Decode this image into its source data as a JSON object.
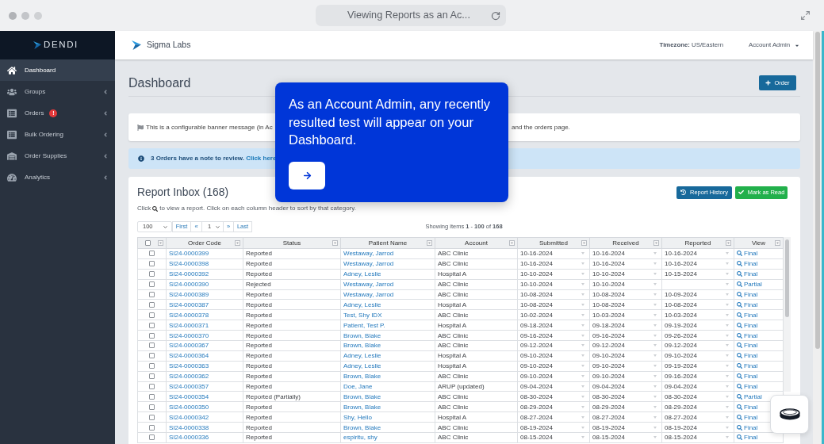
{
  "browser": {
    "address": "Viewing Reports as an Ac..."
  },
  "sidebar": {
    "logo": "DENDI",
    "items": [
      {
        "label": "Dashboard",
        "selected": true,
        "has_submenu": false
      },
      {
        "label": "Groups",
        "selected": false,
        "has_submenu": true
      },
      {
        "label": "Orders",
        "selected": false,
        "has_submenu": true,
        "badge": "!"
      },
      {
        "label": "Bulk Ordering",
        "selected": false,
        "has_submenu": true
      },
      {
        "label": "Order Supplies",
        "selected": false,
        "has_submenu": true
      },
      {
        "label": "Analytics",
        "selected": false,
        "has_submenu": true
      }
    ]
  },
  "header": {
    "organization": "Sigma Labs",
    "timezone": "**Timezone:** US/Eastern",
    "user_menu": "Account Admin"
  },
  "page": {
    "title": "Dashboard",
    "order_button": "Order"
  },
  "banner": {
    "text_start": "This is a configurable banner message (in Ac",
    "text_end": "and the orders page."
  },
  "alert": {
    "message": "3 Orders have a note to review.",
    "link": "Click here"
  },
  "tooltip": {
    "text": "As an Account Admin, any recently resulted test will appear on your Dashboard."
  },
  "report_inbox": {
    "title": "Report Inbox (168)",
    "buttons": [
      {
        "label": "Report History",
        "kind": "history"
      },
      {
        "label": "Mark as Read",
        "kind": "mark_read"
      }
    ],
    "hint_start": "Click",
    "hint_end": "to view a report. Click on each column header to sort by that category.",
    "page_size": "100",
    "pager": {
      "first": "First",
      "previous": "«",
      "page": "1",
      "next": "»",
      "last": "Last"
    },
    "showing": "Showing items **1** - **100** of **168**",
    "table": {
      "select_all": false,
      "columns": [
        "Order Code",
        "Status",
        "Patient Name",
        "Account",
        "Submitted",
        "Received",
        "Reported",
        "View"
      ],
      "rows": [
        {
          "checked": false,
          "order_code": "SI24-0000399",
          "status": "Reported",
          "patient": "Westaway, Jarrod",
          "account": "ABC Clinic",
          "submitted": "10-16-2024",
          "received": "10-16-2024",
          "reported": "10-16-2024",
          "view": "Final"
        },
        {
          "checked": false,
          "order_code": "SI24-0000398",
          "status": "Reported",
          "patient": "Westaway, Jarrod",
          "account": "ABC Clinic",
          "submitted": "10-16-2024",
          "received": "10-16-2024",
          "reported": "10-16-2024",
          "view": "Final"
        },
        {
          "checked": false,
          "order_code": "SI24-0000392",
          "status": "Reported",
          "patient": "Adney, Leslie",
          "account": "Hospital A",
          "submitted": "10-10-2024",
          "received": "10-10-2024",
          "reported": "10-15-2024",
          "view": "Final"
        },
        {
          "checked": false,
          "order_code": "SI24-0000390",
          "status": "Rejected",
          "patient": "Westaway, Jarrod",
          "account": "ABC Clinic",
          "submitted": "10-10-2024",
          "received": "10-10-2024",
          "view": "Partial"
        },
        {
          "checked": false,
          "order_code": "SI24-0000389",
          "status": "Reported",
          "patient": "Westaway, Jarrod",
          "account": "ABC Clinic",
          "submitted": "10-08-2024",
          "received": "10-08-2024",
          "reported": "10-09-2024",
          "view": "Final"
        },
        {
          "checked": false,
          "order_code": "SI24-0000387",
          "status": "Reported",
          "patient": "Adney, Leslie",
          "account": "Hospital A",
          "submitted": "10-08-2024",
          "received": "10-08-2024",
          "reported": "10-08-2024",
          "view": "Final"
        },
        {
          "checked": false,
          "order_code": "SI24-0000378",
          "status": "Reported",
          "patient": "Test, Shy IDX",
          "account": "ABC Clinic",
          "submitted": "10-02-2024",
          "received": "10-03-2024",
          "reported": "10-03-2024",
          "view": "Final"
        },
        {
          "checked": false,
          "order_code": "SI24-0000371",
          "status": "Reported",
          "patient": "Patient, Test P.",
          "account": "Hospital A",
          "submitted": "09-18-2024",
          "received": "09-18-2024",
          "reported": "09-19-2024",
          "view": "Final"
        },
        {
          "checked": false,
          "order_code": "SI24-0000370",
          "status": "Reported",
          "patient": "Brown, Blake",
          "account": "ABC Clinic",
          "submitted": "09-16-2024",
          "received": "09-16-2024",
          "reported": "09-26-2024",
          "view": "Final"
        },
        {
          "checked": false,
          "order_code": "SI24-0000367",
          "status": "Reported",
          "patient": "Brown, Blake",
          "account": "ABC Clinic",
          "submitted": "09-12-2024",
          "received": "09-12-2024",
          "reported": "09-12-2024",
          "view": "Final"
        },
        {
          "checked": false,
          "order_code": "SI24-0000364",
          "status": "Reported",
          "patient": "Adney, Leslie",
          "account": "Hospital A",
          "submitted": "09-10-2024",
          "received": "09-10-2024",
          "reported": "09-10-2024",
          "view": "Final"
        },
        {
          "checked": false,
          "order_code": "SI24-0000363",
          "status": "Reported",
          "patient": "Adney, Leslie",
          "account": "Hospital A",
          "submitted": "09-10-2024",
          "received": "09-10-2024",
          "reported": "09-19-2024",
          "view": "Final"
        },
        {
          "checked": false,
          "order_code": "SI24-0000362",
          "status": "Reported",
          "patient": "Brown, Blake",
          "account": "ABC Clinic",
          "submitted": "09-10-2024",
          "received": "09-10-2024",
          "reported": "09-16-2024",
          "view": "Final"
        },
        {
          "checked": false,
          "order_code": "SI24-0000357",
          "status": "Reported",
          "patient": "Doe, Jane",
          "account": "ARUP (updated)",
          "submitted": "09-04-2024",
          "received": "09-04-2024",
          "reported": "09-04-2024",
          "view": "Final"
        },
        {
          "checked": false,
          "order_code": "SI24-0000354",
          "status": "Reported (Partially)",
          "patient": "Brown, Blake",
          "account": "ABC Clinic",
          "submitted": "08-30-2024",
          "received": "08-30-2024",
          "reported": "08-30-2024",
          "view": "Partial"
        },
        {
          "checked": false,
          "order_code": "SI24-0000350",
          "status": "Reported",
          "patient": "Brown, Blake",
          "account": "ABC Clinic",
          "submitted": "08-29-2024",
          "received": "08-29-2024",
          "reported": "08-29-2024",
          "view": "Final"
        },
        {
          "checked": false,
          "order_code": "SI24-0000342",
          "status": "Reported",
          "patient": "Shy, Hello",
          "account": "Hospital A",
          "submitted": "08-27-2024",
          "received": "08-27-2024",
          "reported": "08-27-2024",
          "view": "Final"
        },
        {
          "checked": false,
          "order_code": "SI24-0000338",
          "status": "Reported",
          "patient": "Brown, Blake",
          "account": "ABC Clinic",
          "submitted": "08-19-2024",
          "received": "08-19-2024",
          "reported": "08-19-2024",
          "view": "Final"
        },
        {
          "checked": false,
          "order_code": "SI24-0000336",
          "status": "Reported",
          "patient": "espiritu, shy",
          "account": "ABC Clinic",
          "submitted": "08-15-2024",
          "received": "08-15-2024",
          "reported": "08-15-2024",
          "view": "Final"
        }
      ]
    }
  }
}
